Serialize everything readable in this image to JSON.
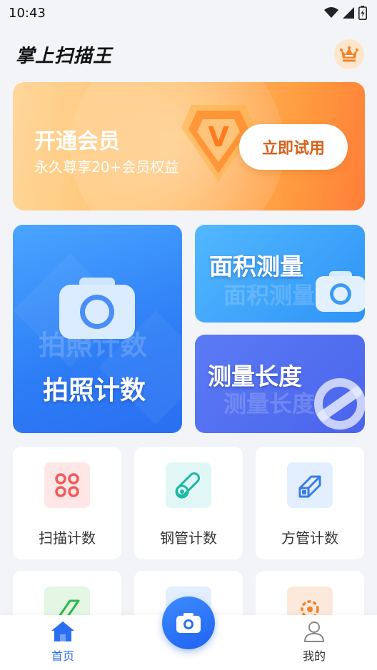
{
  "status_bar": {
    "time": "10:43"
  },
  "header": {
    "app_title": "掌上扫描王",
    "crown_icon": "crown-icon"
  },
  "vip_banner": {
    "title": "开通会员",
    "subtitle": "永久尊享20+会员权益",
    "button_label": "立即试用",
    "badge_letter": "V"
  },
  "features": {
    "photo_count": {
      "label": "拍照计数",
      "watermark": "拍照计数"
    },
    "area_measure": {
      "label": "面积测量",
      "watermark": "面积测量"
    },
    "length_measure": {
      "label": "测量长度",
      "watermark": "测量长度"
    }
  },
  "tools": [
    {
      "label": "扫描计数",
      "icon": "scan-count-icon"
    },
    {
      "label": "钢管计数",
      "icon": "steel-pipe-icon"
    },
    {
      "label": "方管计数",
      "icon": "square-tube-icon"
    },
    {
      "label": "",
      "icon": "green-bar-icon"
    },
    {
      "label": "",
      "icon": "blue-tool-icon"
    },
    {
      "label": "",
      "icon": "gear-icon"
    }
  ],
  "tabbar": {
    "home_label": "首页",
    "mine_label": "我的"
  },
  "colors": {
    "primary": "#2a6ff2",
    "vip_orange": "#ff9a3e",
    "vip_button_text": "#d6621b"
  }
}
